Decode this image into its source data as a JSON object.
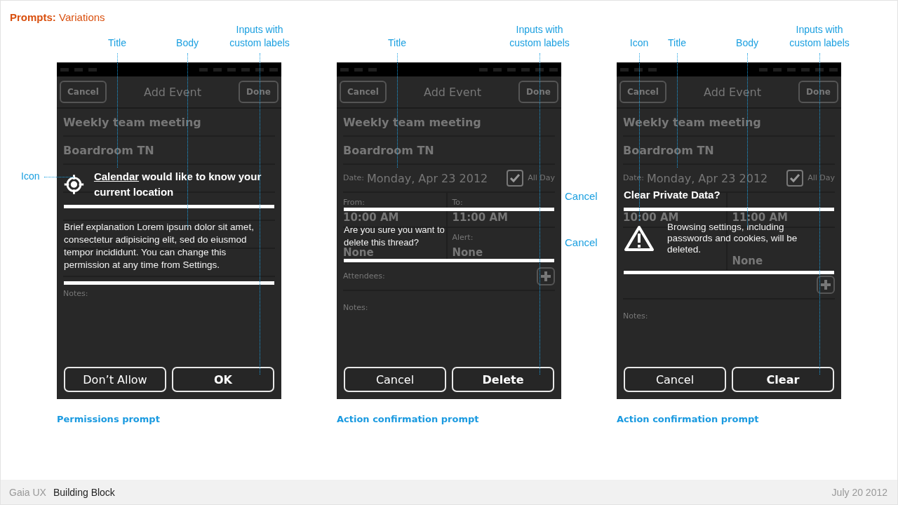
{
  "title": "**Prompts:** Variations",
  "panels": [
    {
      "annotations": [
        {
          "kind": "icon_side",
          "text": "Icon"
        },
        {
          "kind": "title",
          "text": "Title"
        },
        {
          "kind": "body",
          "text": "Body"
        },
        {
          "kind": "inputs",
          "text": "Inputs with custom labels"
        }
      ],
      "form": {
        "cancel": "Cancel",
        "title": "Add Event",
        "done": "Done",
        "rows": [
          {
            "kind": "text",
            "value": "Weekly team meeting"
          },
          {
            "kind": "text",
            "value": "Boardroom TN"
          },
          {
            "kind": "covered"
          },
          {
            "kind": "covered"
          },
          {
            "kind": "covered"
          },
          {
            "kind": "covered"
          },
          {
            "kind": "notes",
            "label": "Notes:"
          }
        ]
      },
      "prompt": {
        "kind": "permission",
        "link": "Calendar",
        "title": "would like to know your current location",
        "body": "Brief explanation Lorem ipsum dolor sit amet, consectetur adipisicing elit, sed do eiusmod tempor incididunt. You can change this permission at any time from Settings.",
        "buttons": [
          {
            "label": "Don’t Allow",
            "primary": false
          },
          {
            "label": "OK",
            "primary": true
          }
        ]
      },
      "caption": "Permissions prompt"
    },
    {
      "annotations": [
        {
          "kind": "title",
          "text": "Title"
        },
        {
          "kind": "inputs",
          "text": "Inputs with custom labels"
        }
      ],
      "side_labels": [
        "Cancel",
        "Cancel"
      ],
      "form": {
        "cancel": "Cancel",
        "title": "Add Event",
        "done": "Done",
        "rows": [
          {
            "kind": "text",
            "value": "Weekly team meeting"
          },
          {
            "kind": "text",
            "value": "Boardroom TN"
          },
          {
            "kind": "date",
            "label": "Date:",
            "value": "Monday, Apr 23 2012",
            "checked": true,
            "check_label": "All Day"
          },
          {
            "kind": "pair",
            "left": {
              "label": "From:",
              "value": "10:00 AM"
            },
            "right": {
              "label": "To:",
              "value": "11:00 AM"
            }
          },
          {
            "kind": "pair",
            "left": {
              "value": "None"
            },
            "right": {
              "label": "Alert:",
              "value": "None"
            }
          },
          {
            "kind": "attendees",
            "label": "Attendees:"
          },
          {
            "kind": "notes",
            "label": "Notes:"
          }
        ]
      },
      "prompt": {
        "kind": "confirmation",
        "body": "Are you sure you want to delete this thread?",
        "buttons": [
          {
            "label": "Cancel",
            "primary": false
          },
          {
            "label": "Delete",
            "primary": true
          }
        ]
      },
      "caption": "Action confirmation prompt"
    },
    {
      "annotations": [
        {
          "kind": "icon",
          "text": "Icon"
        },
        {
          "kind": "title",
          "text": "Title"
        },
        {
          "kind": "body",
          "text": "Body"
        },
        {
          "kind": "inputs",
          "text": "Inputs with custom labels"
        }
      ],
      "form": {
        "cancel": "Cancel",
        "title": "Add Event",
        "done": "Done",
        "rows": [
          {
            "kind": "text",
            "value": "Weekly team meeting"
          },
          {
            "kind": "text",
            "value": "Boardroom TN"
          },
          {
            "kind": "date",
            "label": "Date:",
            "value": "Monday, Apr 23 2012",
            "checked": true,
            "check_label": "All Day"
          },
          {
            "kind": "pair",
            "left": {
              "value": "10:00 AM"
            },
            "right": {
              "value": "11:00 AM"
            }
          },
          {
            "kind": "pair",
            "right": {
              "value": "None"
            }
          },
          {
            "kind": "attendees"
          },
          {
            "kind": "notes",
            "label": "Notes:"
          }
        ]
      },
      "prompt": {
        "kind": "warning",
        "title": "Clear Private Data?",
        "body": "Browsing settings, including passwords and cookies, will be deleted.",
        "buttons": [
          {
            "label": "Cancel",
            "primary": false
          },
          {
            "label": "Clear",
            "primary": true
          }
        ]
      },
      "caption": "Action confirmation prompt"
    }
  ],
  "footer": {
    "product": "Gaia UX",
    "section": "Building Block",
    "date": "July 20 2012"
  }
}
